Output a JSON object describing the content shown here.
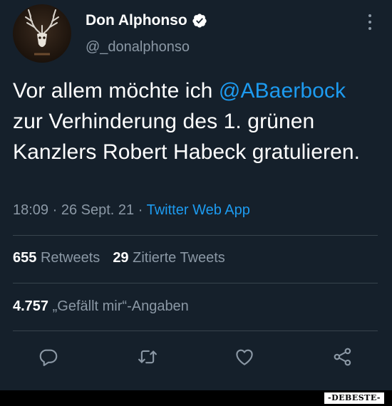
{
  "author": {
    "display_name": "Don Alphonso",
    "handle": "@_donalphonso",
    "verified_icon": "verified-badge-icon"
  },
  "tweet": {
    "text_before": "Vor allem möchte ich ",
    "mention": "@ABaerbock",
    "text_after": " zur Verhinderung des 1. grünen Kanzlers Robert Habeck gratulieren.",
    "time": "18:09",
    "separator": "·",
    "date": "26 Sept. 21",
    "source": "Twitter Web App"
  },
  "stats": {
    "retweets_count": "655",
    "retweets_label": "Retweets",
    "quotes_count": "29",
    "quotes_label": "Zitierte Tweets",
    "likes_count": "4.757",
    "likes_label": "„Gefällt mir“-Angaben"
  },
  "actions": {
    "reply_icon": "reply-icon",
    "retweet_icon": "retweet-icon",
    "like_icon": "heart-icon",
    "share_icon": "share-icon"
  },
  "watermark": "-DEBESTE-",
  "colors": {
    "background": "#15202b",
    "text": "#ffffff",
    "secondary": "#8b98a5",
    "accent": "#1d9bf0",
    "divider": "#38444d"
  }
}
